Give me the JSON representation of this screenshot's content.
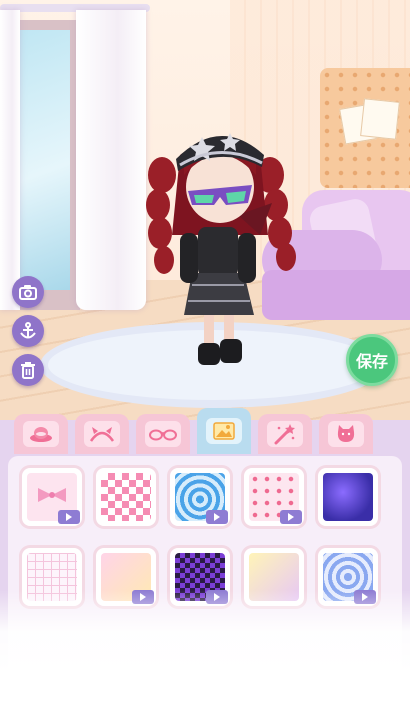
{
  "app": {
    "accent": "#8f74c9",
    "save_color": "#4bc77d"
  },
  "save_button": {
    "label": "保存"
  },
  "side_buttons": [
    {
      "icon": "camera-icon"
    },
    {
      "icon": "anchor-icon"
    },
    {
      "icon": "trash-icon"
    }
  ],
  "tabs": [
    {
      "icon": "hat-icon",
      "active": false
    },
    {
      "icon": "headband-icon",
      "active": false
    },
    {
      "icon": "glasses-icon",
      "active": false
    },
    {
      "icon": "background-image-icon",
      "active": true
    },
    {
      "icon": "magic-wand-icon",
      "active": false
    },
    {
      "icon": "pet-cat-icon",
      "active": false
    }
  ],
  "backgrounds": [
    {
      "name": "pink-bow",
      "video": true
    },
    {
      "name": "pink-checker",
      "video": false
    },
    {
      "name": "blue-heart-rings",
      "video": true
    },
    {
      "name": "pink-hearts",
      "video": true
    },
    {
      "name": "purple-galaxy",
      "video": false
    },
    {
      "name": "pastel-grid-hearts",
      "video": false
    },
    {
      "name": "pink-stars",
      "video": true
    },
    {
      "name": "purple-checker",
      "video": true
    },
    {
      "name": "yellow-heart",
      "video": false
    },
    {
      "name": "blue-star",
      "video": true
    }
  ]
}
